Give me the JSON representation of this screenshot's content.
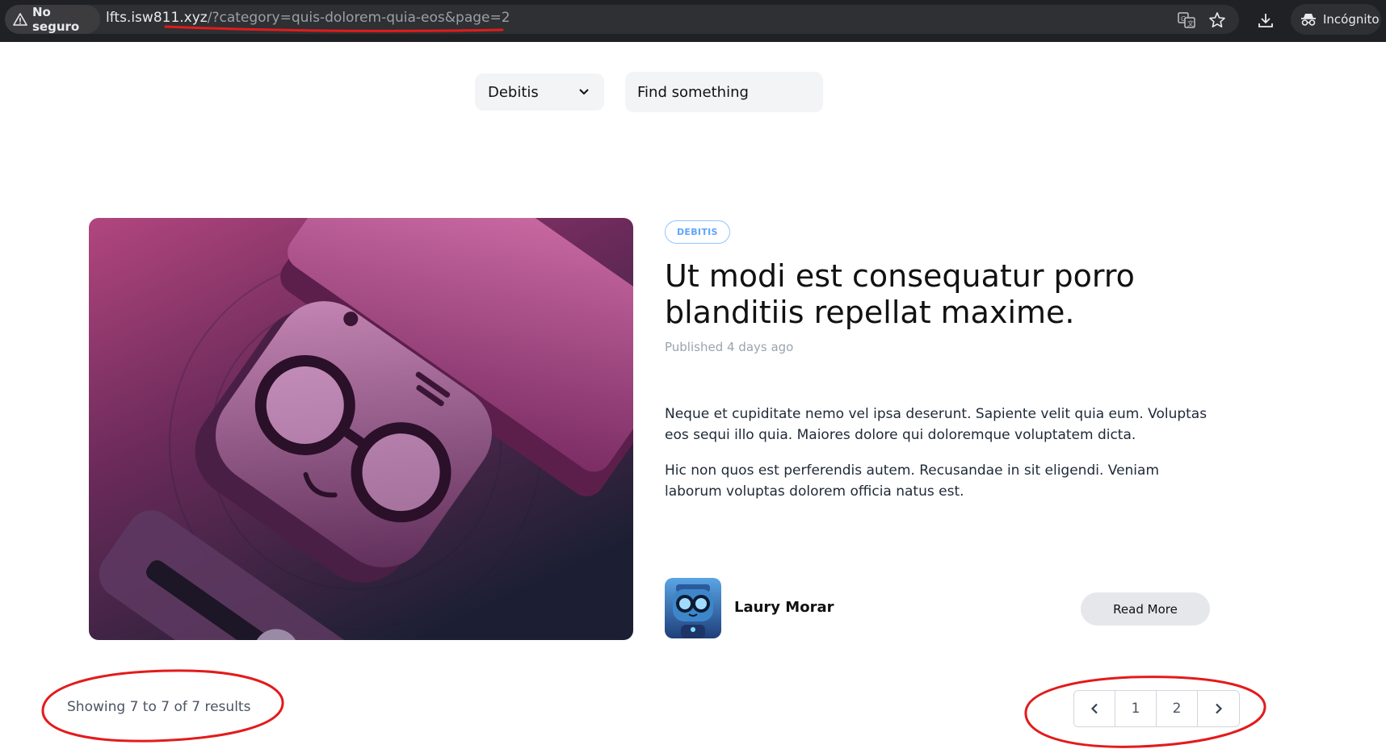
{
  "browser": {
    "security_label": "No seguro",
    "url_host": "lfts.isw811.xyz",
    "url_rest": "/?category=quis-dolorem-quia-eos&page=2",
    "incognito_label": "Incógnito",
    "icons": [
      "warning-icon",
      "translate-icon",
      "star-icon",
      "download-icon",
      "incognito-icon"
    ]
  },
  "filters": {
    "category_selected": "Debitis",
    "search_placeholder": "Find something"
  },
  "post": {
    "category_badge": "DEBITIS",
    "title": "Ut modi est consequatur porro blanditiis repellat maxime.",
    "published": "Published 4 days ago",
    "body": [
      "Neque et cupiditate nemo vel ipsa deserunt. Sapiente velit quia eum. Voluptas eos sequi illo quia. Maiores dolore qui doloremque voluptatem dicta.",
      "Hic non quos est perferendis autem. Recusandae in sit eligendi. Veniam laborum voluptas dolorem officia natus est."
    ],
    "author_name": "Laury Morar",
    "read_more_label": "Read More"
  },
  "pagination": {
    "results_text": "Showing 7 to 7 of 7 results",
    "pages": [
      "1",
      "2"
    ]
  },
  "colors": {
    "annotation_red": "#e31b1b",
    "badge_blue": "#60a5fa",
    "browser_bar": "#202124"
  }
}
